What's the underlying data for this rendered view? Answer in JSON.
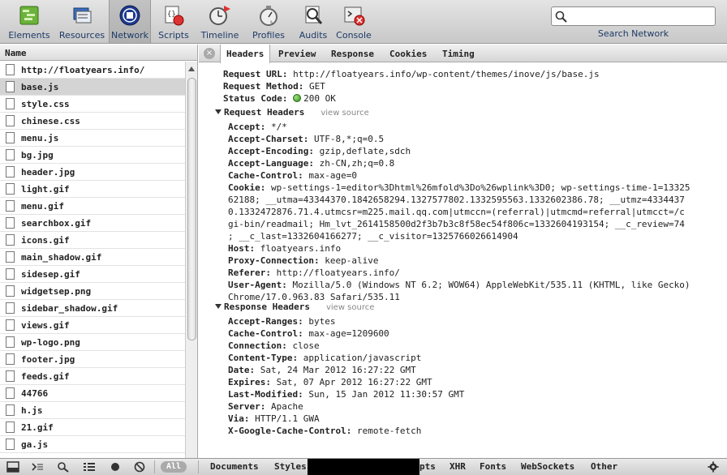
{
  "toolbar": {
    "tools": [
      {
        "label": "Elements",
        "icon": "elements-icon"
      },
      {
        "label": "Resources",
        "icon": "resources-icon"
      },
      {
        "label": "Network",
        "icon": "network-icon",
        "active": true
      },
      {
        "label": "Scripts",
        "icon": "scripts-icon"
      },
      {
        "label": "Timeline",
        "icon": "timeline-icon"
      },
      {
        "label": "Profiles",
        "icon": "profiles-icon"
      },
      {
        "label": "Audits",
        "icon": "audits-icon"
      },
      {
        "label": "Console",
        "icon": "console-icon"
      }
    ],
    "search_label": "Search Network",
    "search_value": ""
  },
  "left_pane": {
    "header": "Name",
    "files": [
      "http://floatyears.info/",
      "base.js",
      "style.css",
      "chinese.css",
      "menu.js",
      "bg.jpg",
      "header.jpg",
      "light.gif",
      "menu.gif",
      "searchbox.gif",
      "icons.gif",
      "main_shadow.gif",
      "sidesep.gif",
      "widgetsep.png",
      "sidebar_shadow.gif",
      "views.gif",
      "wp-logo.png",
      "footer.jpg",
      "feeds.gif",
      "44766",
      "h.js",
      "21.gif",
      "ga.js"
    ],
    "selected_index": 1
  },
  "tabs": [
    "Headers",
    "Preview",
    "Response",
    "Cookies",
    "Timing"
  ],
  "details": {
    "request_url_label": "Request URL:",
    "request_url": "http://floatyears.info/wp-content/themes/inove/js/base.js",
    "request_method_label": "Request Method:",
    "request_method": "GET",
    "status_code_label": "Status Code:",
    "status_code": "200 OK",
    "request_headers_title": "Request Headers",
    "response_headers_title": "Response Headers",
    "view_source": "view source",
    "request_headers": [
      {
        "k": "Accept:",
        "v": "*/*"
      },
      {
        "k": "Accept-Charset:",
        "v": "UTF-8,*;q=0.5"
      },
      {
        "k": "Accept-Encoding:",
        "v": "gzip,deflate,sdch"
      },
      {
        "k": "Accept-Language:",
        "v": "zh-CN,zh;q=0.8"
      },
      {
        "k": "Cache-Control:",
        "v": "max-age=0"
      },
      {
        "k": "Cookie:",
        "v": "wp-settings-1=editor%3Dhtml%26mfold%3Do%26wplink%3D0; wp-settings-time-1=13325"
      },
      {
        "k": "",
        "v": "62188; __utma=43344370.1842658294.1327577802.1332595563.1332602386.78; __utmz=4334437"
      },
      {
        "k": "",
        "v": "0.1332472876.71.4.utmcsr=m225.mail.qq.com|utmccn=(referral)|utmcmd=referral|utmcct=/c"
      },
      {
        "k": "",
        "v": "gi-bin/readmail; Hm_lvt_2614158500d2f3b7b3c8f58ec54f806c=1332604193154; __c_review=74"
      },
      {
        "k": "",
        "v": "; __c_last=1332604166277; __c_visitor=1325766026614904"
      },
      {
        "k": "Host:",
        "v": "floatyears.info"
      },
      {
        "k": "Proxy-Connection:",
        "v": "keep-alive"
      },
      {
        "k": "Referer:",
        "v": "http://floatyears.info/"
      },
      {
        "k": "User-Agent:",
        "v": "Mozilla/5.0 (Windows NT 6.2; WOW64) AppleWebKit/535.11 (KHTML, like Gecko)"
      },
      {
        "k": "",
        "v": " Chrome/17.0.963.83 Safari/535.11"
      }
    ],
    "response_headers": [
      {
        "k": "Accept-Ranges:",
        "v": "bytes"
      },
      {
        "k": "Cache-Control:",
        "v": "max-age=1209600"
      },
      {
        "k": "Connection:",
        "v": "close"
      },
      {
        "k": "Content-Type:",
        "v": "application/javascript"
      },
      {
        "k": "Date:",
        "v": "Sat, 24 Mar 2012 16:27:22 GMT"
      },
      {
        "k": "Expires:",
        "v": "Sat, 07 Apr 2012 16:27:22 GMT"
      },
      {
        "k": "Last-Modified:",
        "v": "Sun, 15 Jan 2012 11:30:57 GMT"
      },
      {
        "k": "Server:",
        "v": "Apache"
      },
      {
        "k": "Via:",
        "v": "HTTP/1.1 GWA"
      },
      {
        "k": "X-Google-Cache-Control:",
        "v": "remote-fetch"
      }
    ]
  },
  "statusbar": {
    "all_label": "All",
    "filters": [
      "Documents",
      "Styles",
      "pts",
      "XHR",
      "Fonts",
      "WebSockets",
      "Other"
    ]
  },
  "colors": {
    "label_blue": "#1d3a67",
    "status_green": "#2f8f1e"
  }
}
